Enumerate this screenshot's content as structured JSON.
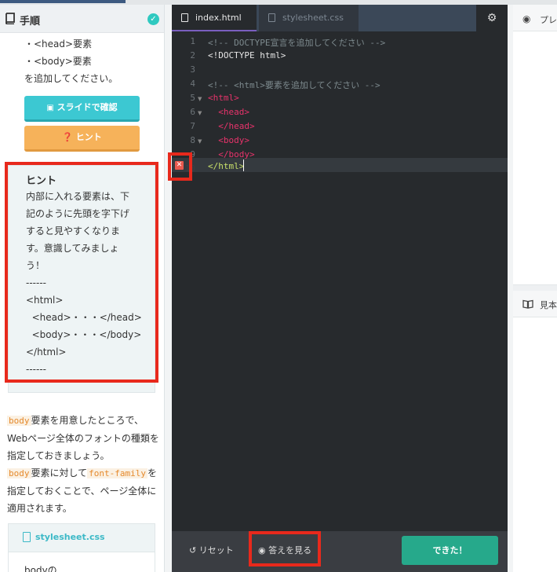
{
  "left_panel": {
    "header_title": "手順",
    "step_lines": [
      "・<head>要素",
      "・<body>要素",
      "を追加してください。"
    ],
    "slide_button": "スライドで確認",
    "hint_button": "ヒント",
    "hint": {
      "heading": "ヒント",
      "lines": [
        "内部に入れる要素は、下",
        "記のように先頭を字下げ",
        "すると見やすくなりま",
        "す。意識してみましょ",
        "う！",
        "------",
        "<html>",
        "  <head>・・・</head>",
        "  <body>・・・</body>",
        "</html>",
        "------"
      ]
    },
    "paragraph": {
      "code1": "body",
      "text1": "要素を用意したところで、Webページ全体のフォントの種類を指定しておきましょう。",
      "code2": "body",
      "text2": "要素に対して",
      "code3": "font-family",
      "text3": "を指定しておくことで、ページ全体に適用されます。"
    },
    "css_card": {
      "filename": "stylesheet.css",
      "text": "bodyの"
    }
  },
  "editor": {
    "tabs": [
      {
        "label": "index.html",
        "active": true
      },
      {
        "label": "stylesheet.css",
        "active": false
      }
    ],
    "settings_icon": "gear-icon",
    "line_numbers": [
      "1",
      "2",
      "3",
      "4",
      "5",
      "6",
      "7",
      "8",
      "9",
      "10"
    ],
    "lines": [
      "<!-- DOCTYPE宣言を追加してください -->",
      "<!DOCTYPE html>",
      "",
      "<!-- <html>要素を追加してください -->",
      "<html>",
      "  <head>",
      "  </head>",
      "  <body>",
      "  </body>",
      "</html>"
    ],
    "reset_label": "リセット",
    "answer_label": "答えを見る",
    "done_label": "できた！"
  },
  "right_panel": {
    "preview_label": "プレビュー",
    "sample_label": "見本"
  },
  "colors": {
    "accent_red": "#e8291c",
    "done_green": "#26a98b",
    "slide_cyan": "#3cc8d2",
    "hint_orange": "#f6b25a"
  }
}
